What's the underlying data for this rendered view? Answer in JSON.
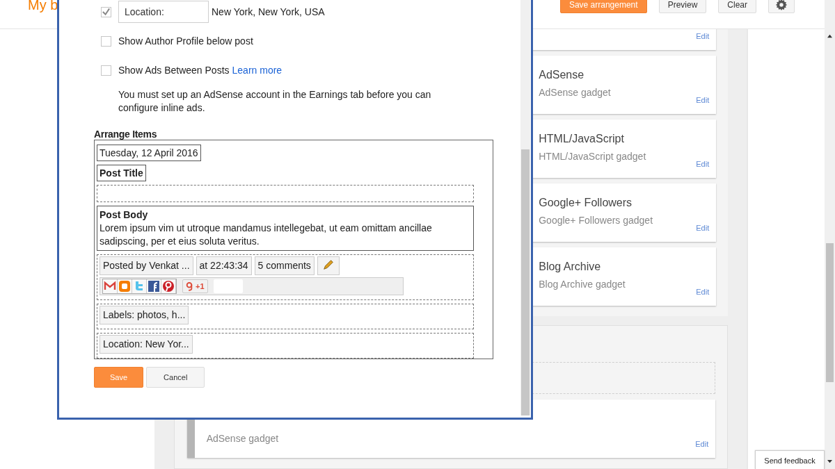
{
  "header": {
    "title": "My b",
    "buttons": [
      {
        "label": "Save arrangement",
        "kind": "primary"
      },
      {
        "label": "Preview",
        "kind": "default"
      },
      {
        "label": "Clear",
        "kind": "default"
      }
    ]
  },
  "gadgets": [
    {
      "action": "Edit"
    },
    {
      "title": "AdSense",
      "subtitle": "AdSense gadget",
      "action": "Edit"
    },
    {
      "title": "HTML/JavaScript",
      "subtitle": "HTML/JavaScript gadget",
      "action": "Edit"
    },
    {
      "title": "Google+ Followers",
      "subtitle": "Google+ Followers gadget",
      "action": "Edit"
    },
    {
      "title": "Blog Archive",
      "subtitle": "Blog Archive gadget",
      "action": "Edit"
    }
  ],
  "lower_section": {
    "gadget": {
      "subtitle": "AdSense gadget",
      "action": "Edit"
    }
  },
  "dialog": {
    "options": [
      {
        "kind": "field",
        "checked": true,
        "field_value": "Location:",
        "text": "New York, New York, USA"
      },
      {
        "kind": "plain",
        "checked": false,
        "text": "Show Author Profile below post"
      },
      {
        "kind": "link",
        "checked": false,
        "text": "Show Ads Between Posts",
        "link": "Learn more"
      }
    ],
    "note": "You must set up an AdSense account in the Earnings tab before you can configure inline ads.",
    "arrange_title": "Arrange Items",
    "arrange": {
      "date": "Tuesday, 12 April 2016",
      "post_title": "Post Title",
      "post_body": {
        "title": "Post Body",
        "text": "Lorem ipsum vim ut utroque mandamus intellegebat, ut eam omittam ancillae sadipscing, per et eius soluta veritus."
      },
      "footer_chips": [
        "Posted by Venkat ...",
        "at 22:43:34",
        "5 comments"
      ],
      "plus_one": "+1",
      "labels": "Labels: photos, h...",
      "location": "Location: New Yor..."
    },
    "buttons": [
      {
        "label": "Save",
        "kind": "primary"
      },
      {
        "label": "Cancel",
        "kind": "default"
      }
    ]
  },
  "feedback": "Send feedback"
}
